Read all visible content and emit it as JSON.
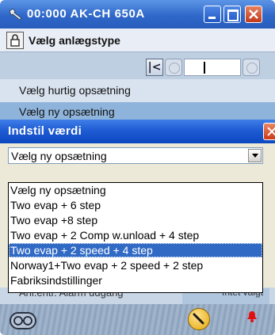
{
  "background_window": {
    "title": "00:000 AK-CH 650A",
    "page_title": "Vælg anlægstype",
    "menu_items": [
      "Vælg hurtig opsætning",
      "Vælg ny opsætning"
    ],
    "lower_left_text": "Anl.entr. Alarm udgang",
    "lower_right_text": "Intet valgt"
  },
  "dialog": {
    "title": "Indstil værdi",
    "combo_value": "Vælg ny opsætning",
    "options": [
      "Vælg ny opsætning",
      "Two evap + 6 step",
      "Two evap +8 step",
      "Two evap + 2 Comp w.unload + 4 step",
      "Two evap + 2 speed + 4 step",
      "Norway1+Two evap + 2 speed + 2 step",
      "Fabriksindstillinger"
    ],
    "selected_index": 4
  },
  "colors": {
    "title_bar": "#2f68c9",
    "selection": "#316ac5",
    "dialog_bg": "#ece9d8"
  },
  "icons": [
    "wrench-app-icon",
    "lock-icon",
    "glasses-icon",
    "wrench-icon",
    "alarm-bell-icon"
  ]
}
